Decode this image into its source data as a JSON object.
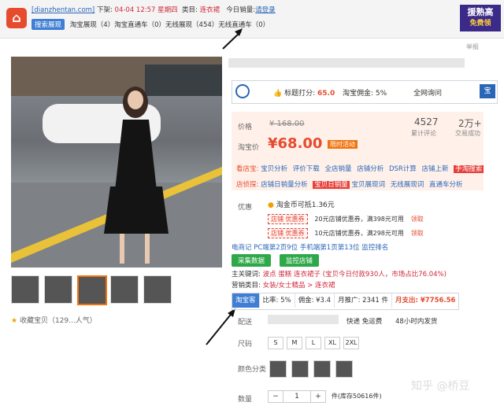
{
  "header": {
    "site": "[dianzhentan.com]",
    "offline_label": "下架:",
    "offline_time": "04-04 12:57 星期四",
    "category_label": "类目:",
    "category": "连衣裙",
    "today_sales_label": "今日销量:",
    "login": "请登录",
    "search_tag": "搜索展现",
    "metrics": "淘宝展现（4）淘宝直通车（0）无线展现（454）无线直通车（0）"
  },
  "ad": {
    "line1": "援熟高",
    "line2": "免费领"
  },
  "close_label": "举报",
  "favorites": "收藏宝贝（129...人气）",
  "plugin_bar": {
    "rating_label": "标题打分:",
    "rating": "65.0",
    "commission_label": "淘宝佣金:",
    "commission": "5%",
    "netwide": "全网询问",
    "right": "宝"
  },
  "price": {
    "label_price": "价格",
    "original": "¥ 168.00",
    "label_promo": "淘宝价",
    "current": "¥68.00",
    "promo_tag": "限时活动",
    "reviews_count": "4527",
    "reviews_label": "累计评论",
    "sales_count": "2万+",
    "sales_label": "交易成功"
  },
  "tools_row1": {
    "label": "看店宝:",
    "items": [
      "宝贝分析",
      "评价下载",
      "全店销量",
      "店铺分析",
      "DSR计算",
      "店铺上新"
    ],
    "hot": "手淘搜索"
  },
  "tools_row2": {
    "label": "店侦探:",
    "items": [
      "店铺日销量分析",
      "宝贝日销量",
      "宝贝展现词",
      "无线展现词",
      "直通车分析"
    ]
  },
  "coupons": {
    "label": "优惠",
    "coin": "淘金币可抵1.36元",
    "rows": [
      {
        "tag": "店铺 优惠券",
        "text": "20元店铺优惠券，满398元可用",
        "action": "领取"
      },
      {
        "tag": "店铺 优惠券",
        "text": "10元店铺优惠券，满298元可用",
        "action": "领取"
      }
    ]
  },
  "rank": "电商记 PC端第2页9位  手机端第1页第13位  监控排名",
  "buttons": {
    "collect": "采集数据",
    "monitor": "监控店铺"
  },
  "keywords": {
    "main_label": "主关键词:",
    "main": "波点 蛋糕 连衣裙子 (宝贝今日付款930人，市场占比76.04%)",
    "cat_label": "营销类目:",
    "cat": "女装/女士精品 > 连衣裙"
  },
  "stats_table": [
    "淘宝客",
    "比率: 5%",
    "佣金: ¥3.4",
    "月推广: 2341 件",
    "月支出: ¥7756.56"
  ],
  "shipping": {
    "label": "配送",
    "express": "快递 免运费",
    "time": "48小时内发货"
  },
  "size": {
    "label": "尺码",
    "options": [
      "S",
      "M",
      "L",
      "XL",
      "2XL"
    ]
  },
  "color": {
    "label": "颜色分类"
  },
  "quantity": {
    "label": "数量",
    "minus": "−",
    "value": "1",
    "plus": "+",
    "stock": "件(库存50616件)"
  },
  "watermark": "知乎 @桥豆"
}
